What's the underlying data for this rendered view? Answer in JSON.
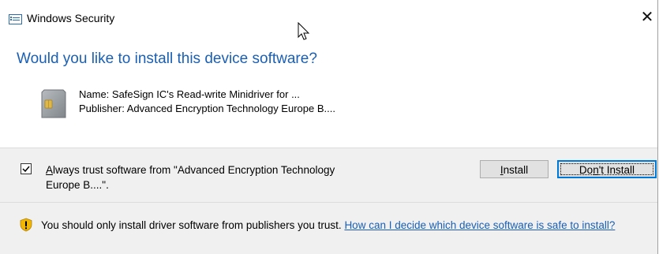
{
  "window": {
    "title": "Windows Security",
    "close_glyph": "✕"
  },
  "heading": "Would you like to install this device software?",
  "device": {
    "name": "Name: SafeSign IC's Read-write Minidriver for ...",
    "publisher": "Publisher: Advanced Encryption Technology Europe B....",
    "icon": "smart-card-icon"
  },
  "trust": {
    "checked": true,
    "mnemonic": "A",
    "label_rest": "lways trust software from \"Advanced Encryption Technology Europe B....\"."
  },
  "buttons": {
    "install_mnemonic": "I",
    "install_rest": "nstall",
    "dont_pre": "Do",
    "dont_mnemonic": "n",
    "dont_rest": "'t Install"
  },
  "warning": {
    "icon": "shield-warning-icon",
    "text": "You should only install driver software from publishers you trust. ",
    "link": "How can I decide which device software is safe to install?"
  },
  "colors": {
    "heading": "#1a5fb4",
    "link": "#1a5fb4",
    "shield": "#f2b705"
  }
}
